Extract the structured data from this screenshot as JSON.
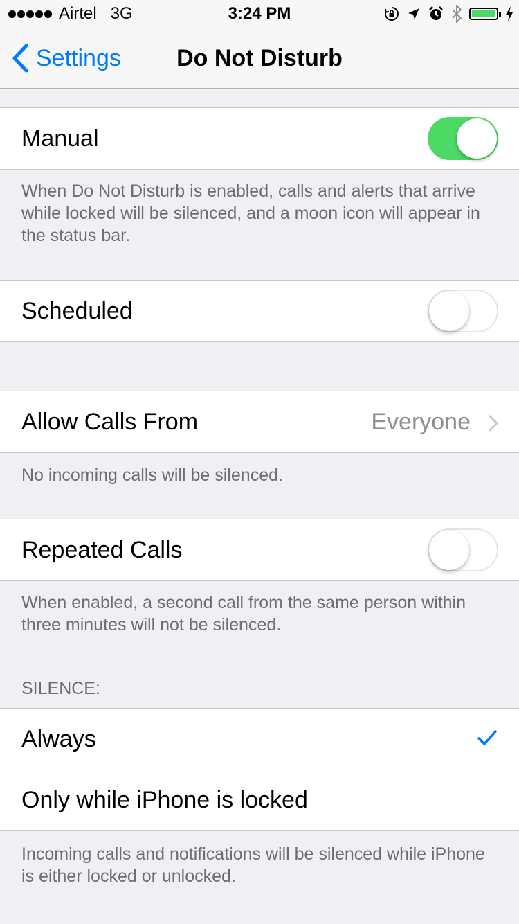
{
  "status_bar": {
    "carrier": "Airtel",
    "network": "3G",
    "time": "3:24 PM",
    "icons": [
      "signal-dots-icon",
      "orientation-lock-icon",
      "location-icon",
      "alarm-icon",
      "bluetooth-icon",
      "battery-icon",
      "charging-icon"
    ],
    "battery_color": "#4cd964"
  },
  "nav": {
    "back_label": "Settings",
    "title": "Do Not Disturb"
  },
  "manual": {
    "label": "Manual",
    "toggle_on": true,
    "footer": "When Do Not Disturb is enabled, calls and alerts that arrive while locked will be silenced, and a moon icon will appear in the status bar."
  },
  "scheduled": {
    "label": "Scheduled",
    "toggle_on": false
  },
  "allow_calls": {
    "label": "Allow Calls From",
    "value": "Everyone",
    "footer": "No incoming calls will be silenced."
  },
  "repeated_calls": {
    "label": "Repeated Calls",
    "toggle_on": false,
    "footer": "When enabled, a second call from the same person within three minutes will not be silenced."
  },
  "silence": {
    "header": "SILENCE:",
    "options": [
      {
        "label": "Always",
        "selected": true
      },
      {
        "label": "Only while iPhone is locked",
        "selected": false
      }
    ],
    "footer": "Incoming calls and notifications will be silenced while iPhone is either locked or unlocked."
  },
  "colors": {
    "accent": "#007aff",
    "toggle_on": "#4cd964",
    "background": "#efeff4"
  }
}
